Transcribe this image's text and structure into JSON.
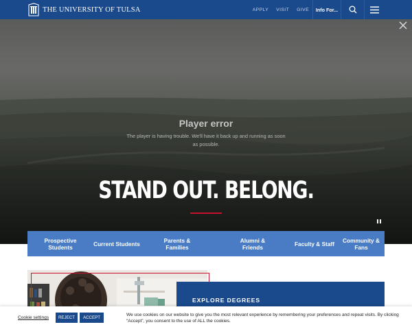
{
  "header": {
    "logo_text": "THE UNIVERSITY OF TULSA",
    "nav": [
      "APPLY",
      "VISIT",
      "GIVE"
    ],
    "info_for": "Info For..."
  },
  "hero": {
    "player_error_title": "Player error",
    "player_error_msg": "The player is having trouble. We'll have it back up and running as soon as possible.",
    "headline": "STAND OUT. BELONG."
  },
  "audience": [
    {
      "label": "Prospective Students"
    },
    {
      "label": "Current Students"
    },
    {
      "label": "Parents & Families"
    },
    {
      "label": "Alumni & Friends"
    },
    {
      "label": "Faculty & Staff"
    },
    {
      "label": "Community & Fans"
    }
  ],
  "explore": {
    "label": "EXPLORE DEGREES"
  },
  "cookie": {
    "settings_label": "Cookie settings",
    "reject_label": "REJECT",
    "accept_label": "ACCEPT",
    "message": "We use cookies on our website to give you the most relevant experience by remembering your preferences and repeat visits. By clicking “Accept”, you consent to the use of ALL the cookies."
  },
  "colors": {
    "brand_blue": "#1a4a8c",
    "audience_blue": "#4a7cc5",
    "accent_red": "#c8102e"
  },
  "icons": [
    "tu-logo-icon",
    "search-icon",
    "menu-icon",
    "close-icon",
    "pause-icon"
  ]
}
